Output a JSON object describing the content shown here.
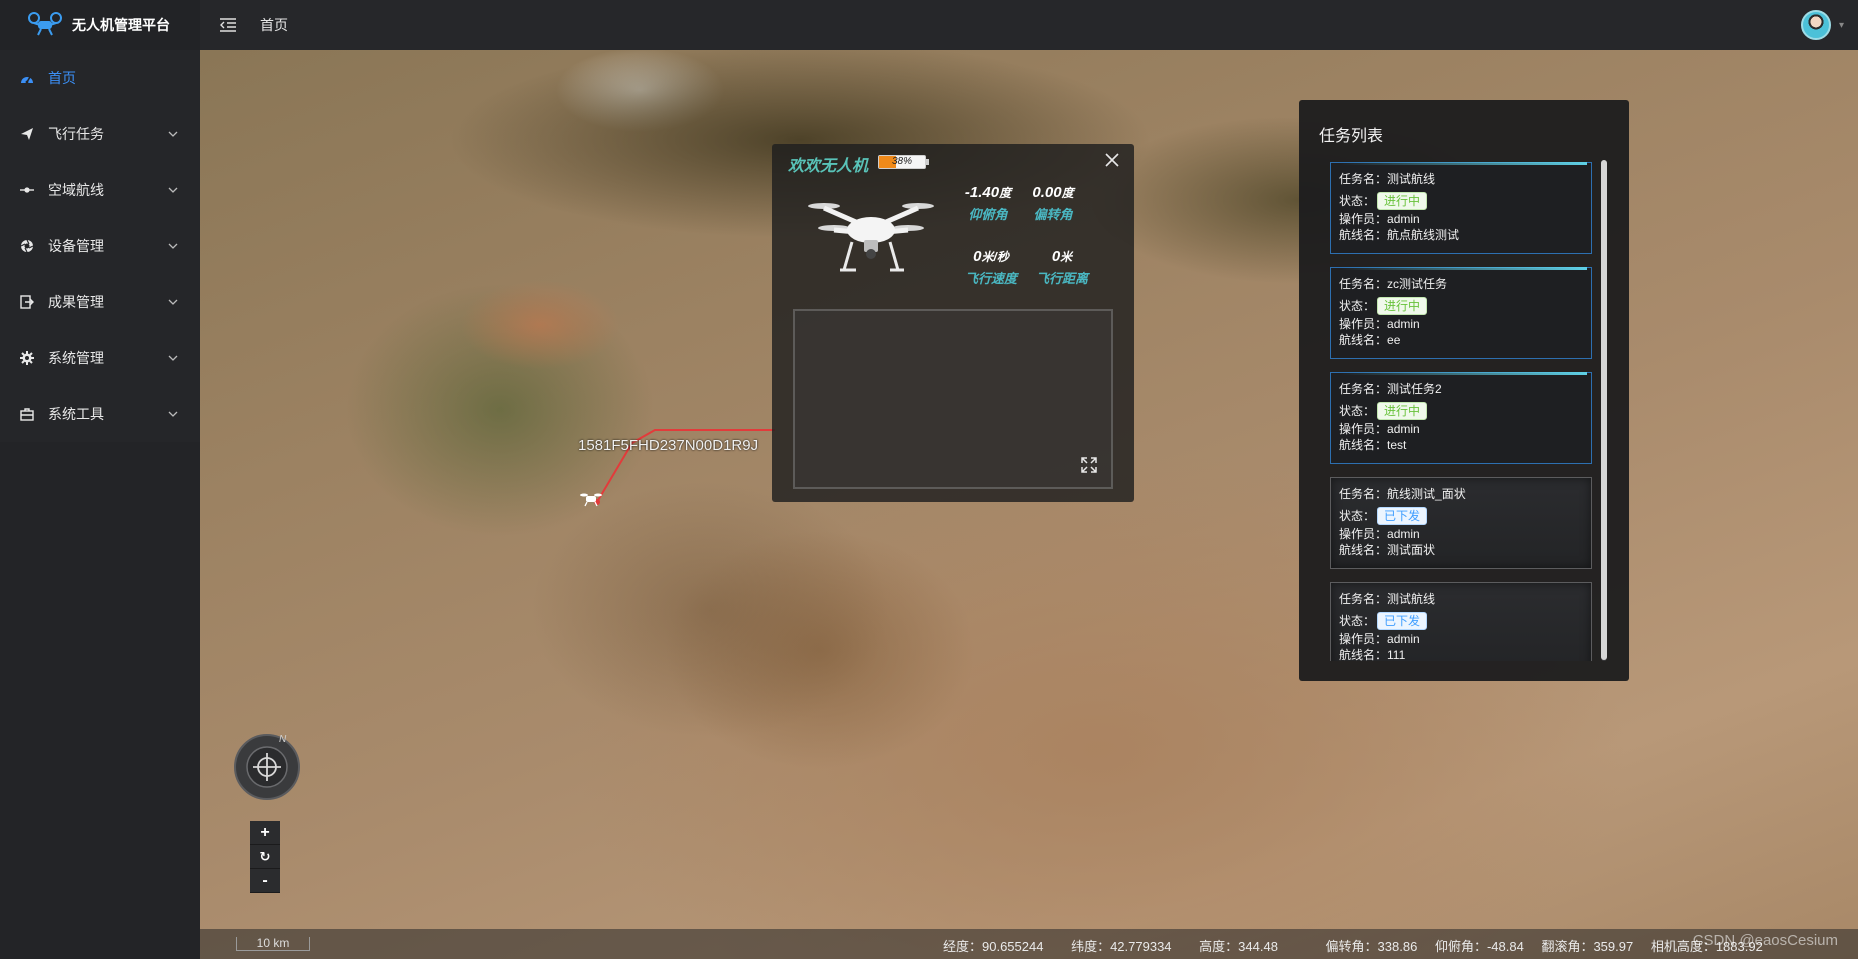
{
  "header": {
    "brand_title": "无人机管理平台",
    "breadcrumb": "首页",
    "icons": {
      "logo": "drone-logo-icon",
      "collapse": "menu-fold-icon",
      "avatar": "user-avatar"
    }
  },
  "sidebar": {
    "items": [
      {
        "label": "首页",
        "icon": "dashboard-icon",
        "active": true,
        "has_children": false
      },
      {
        "label": "飞行任务",
        "icon": "paper-plane-icon",
        "active": false,
        "has_children": true
      },
      {
        "label": "空域航线",
        "icon": "route-icon",
        "active": false,
        "has_children": true
      },
      {
        "label": "设备管理",
        "icon": "aperture-icon",
        "active": false,
        "has_children": true
      },
      {
        "label": "成果管理",
        "icon": "document-export-icon",
        "active": false,
        "has_children": true
      },
      {
        "label": "系统管理",
        "icon": "gear-icon",
        "active": false,
        "has_children": true
      },
      {
        "label": "系统工具",
        "icon": "toolbox-icon",
        "active": false,
        "has_children": true
      }
    ],
    "active_color": "#3b8ff5"
  },
  "map": {
    "drone_serial": "1581F5FHD237N00D1R9J",
    "compass_north": "N",
    "zoom_in": "+",
    "zoom_reset": "↻",
    "zoom_out": "-",
    "scale": "10 km",
    "route_color": "#e23b3b"
  },
  "drone_panel": {
    "title": "欢欢无人机",
    "battery_percent": 38,
    "battery_text": "38%",
    "pitch": {
      "value": "-1.40",
      "unit": "度",
      "label": "仰俯角"
    },
    "yaw": {
      "value": "0.00",
      "unit": "度",
      "label": "偏转角"
    },
    "speed": {
      "value": "0",
      "unit": "米/秒",
      "label": "飞行速度"
    },
    "distance": {
      "value": "0",
      "unit": "米",
      "label": "飞行距离"
    },
    "accent_color": "#59c3b8"
  },
  "task_list": {
    "title": "任务列表",
    "labels": {
      "name": "任务名：",
      "status": "状态：",
      "operator": "操作员：",
      "route": "航线名："
    },
    "tasks": [
      {
        "name": "测试航线",
        "status": "进行中",
        "status_type": "running",
        "operator": "admin",
        "route": "航点航线测试"
      },
      {
        "name": "zc测试任务",
        "status": "进行中",
        "status_type": "running",
        "operator": "admin",
        "route": "ee"
      },
      {
        "name": "测试任务2",
        "status": "进行中",
        "status_type": "running",
        "operator": "admin",
        "route": "test"
      },
      {
        "name": "航线测试_面状",
        "status": "已下发",
        "status_type": "sent",
        "operator": "admin",
        "route": "测试面状"
      },
      {
        "name": "测试航线",
        "status": "已下发",
        "status_type": "sent",
        "operator": "admin",
        "route": "111"
      }
    ]
  },
  "statusbar": {
    "longitude": "经度：90.655244",
    "latitude": "纬度：42.779334",
    "altitude": "高度：344.48",
    "heading": "偏转角：338.86",
    "pitch": "仰俯角：-48.84",
    "roll": "翻滚角：359.97",
    "camera_height": "相机高度：1883.92",
    "watermark": "CSDN @eaosCesium"
  }
}
